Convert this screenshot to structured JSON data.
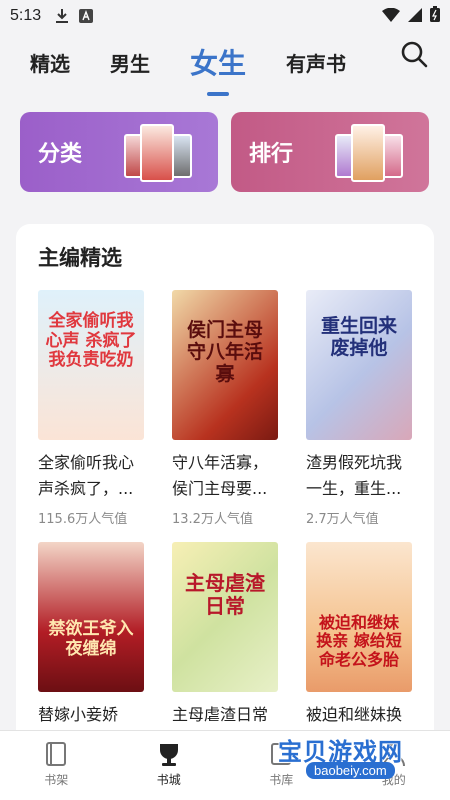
{
  "status_bar": {
    "time": "5:13"
  },
  "tabs": [
    {
      "label": "精选"
    },
    {
      "label": "男生"
    },
    {
      "label": "女生"
    },
    {
      "label": "有声书"
    }
  ],
  "category_cards": [
    {
      "label": "分类"
    },
    {
      "label": "排行"
    }
  ],
  "section": {
    "title": "主编精选",
    "books": [
      {
        "title": "全家偷听我心声杀疯了，...",
        "popularity": "115.6万人气值",
        "cover_text": "全家偷听我心声 杀疯了 我负责吃奶"
      },
      {
        "title": "守八年活寡，侯门主母要...",
        "popularity": "13.2万人气值",
        "cover_text": "侯门主母 守八年活寡"
      },
      {
        "title": "渣男假死坑我一生，重生...",
        "popularity": "2.7万人气值",
        "cover_text": "重生回来 废掉他"
      },
      {
        "title": "替嫁小妾娇",
        "popularity": "",
        "cover_text": "禁欲王爷入夜缠绵"
      },
      {
        "title": "主母虐渣日常",
        "popularity": "",
        "cover_text": "主母虐渣日常"
      },
      {
        "title": "被迫和继妹换",
        "popularity": "",
        "cover_text": "被迫和继妹换亲 嫁给短命老公多胎"
      }
    ]
  },
  "bottom_nav": [
    {
      "label": "书架"
    },
    {
      "label": "书城"
    },
    {
      "label": "书库"
    },
    {
      "label": "我的"
    }
  ],
  "watermark": {
    "text": "宝贝游戏网",
    "domain": "baobeiy.com"
  }
}
